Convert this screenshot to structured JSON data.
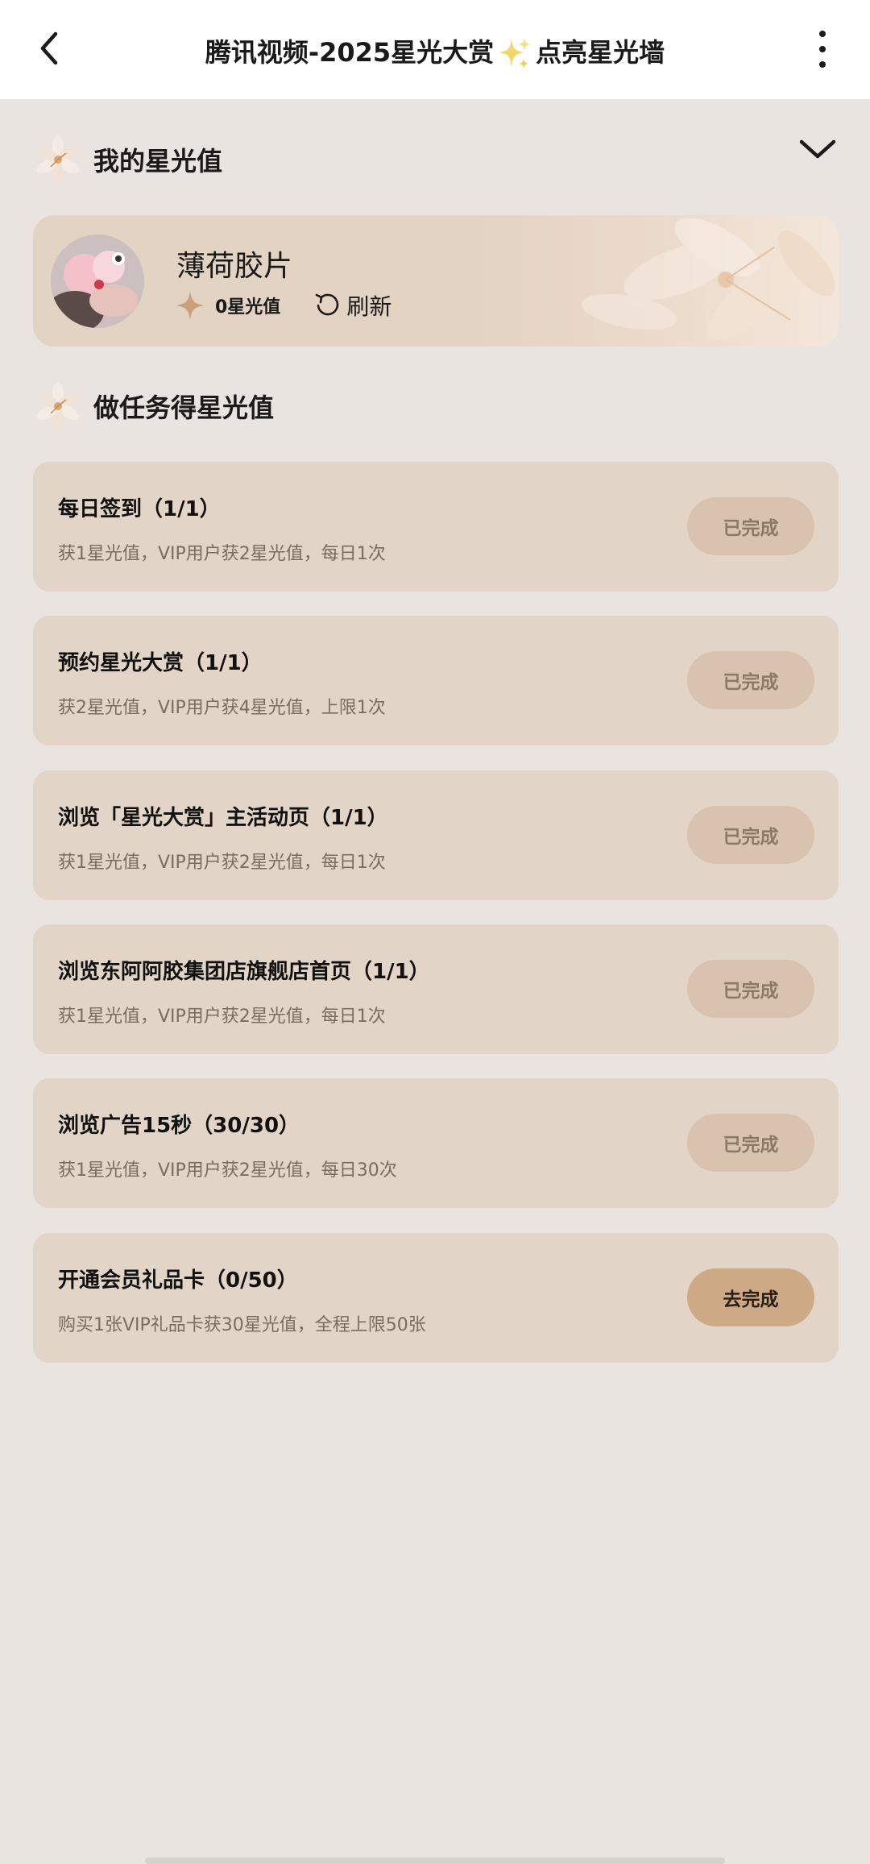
{
  "header": {
    "title_part1": "腾讯视频-2025星光大赏",
    "title_part2": "点亮星光墙"
  },
  "my_section": {
    "title": "我的星光值"
  },
  "profile": {
    "username": "薄荷胶片",
    "star_value": "0星光值",
    "refresh_label": "刷新"
  },
  "task_section": {
    "title": "做任务得星光值"
  },
  "tasks": [
    {
      "title": "每日签到（1/1）",
      "desc": "获1星光值，VIP用户获2星光值，每日1次",
      "button": "已完成",
      "done": true
    },
    {
      "title": "预约星光大赏（1/1）",
      "desc": "获2星光值，VIP用户获4星光值，上限1次",
      "button": "已完成",
      "done": true
    },
    {
      "title": "浏览「星光大赏」主活动页（1/1）",
      "desc": "获1星光值，VIP用户获2星光值，每日1次",
      "button": "已完成",
      "done": true
    },
    {
      "title": "浏览东阿阿胶集团店旗舰店首页（1/1）",
      "desc": "获1星光值，VIP用户获2星光值，每日1次",
      "button": "已完成",
      "done": true
    },
    {
      "title": "浏览广告15秒（30/30）",
      "desc": "获1星光值，VIP用户获2星光值，每日30次",
      "button": "已完成",
      "done": true
    },
    {
      "title": "开通会员礼品卡（0/50）",
      "desc": "购买1张VIP礼品卡获30星光值，全程上限50张",
      "button": "去完成",
      "done": false
    }
  ],
  "colors": {
    "background": "#e9e4e0",
    "card": "#e2d4c7",
    "button_done": "#d9c3ae",
    "button_active": "#cea985",
    "star": "#c9a07a"
  }
}
